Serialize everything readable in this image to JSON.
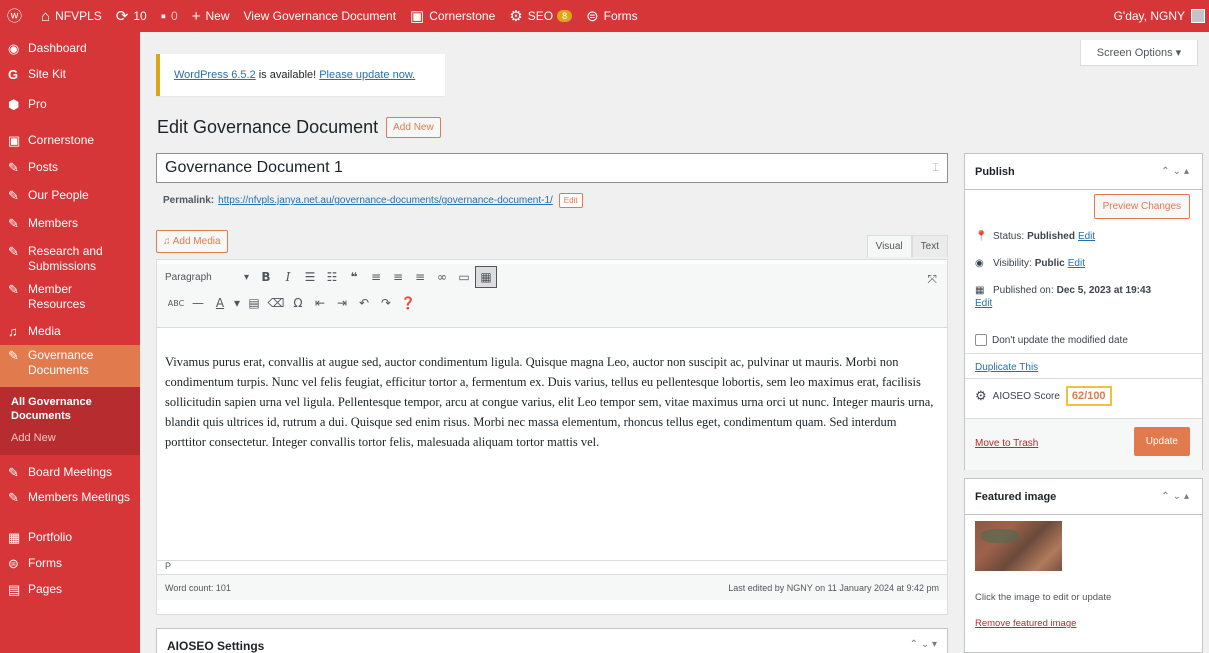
{
  "adminbar": {
    "wp_logo": "wordpress-icon",
    "site_name": "NFVPLS",
    "updates_count": "10",
    "comments_count": "0",
    "new_label": "New",
    "view_label": "View Governance Document",
    "cornerstone_label": "Cornerstone",
    "seo_label": "SEO",
    "seo_badge": "8",
    "forms_label": "Forms",
    "greeting": "G'day, NGNY"
  },
  "sidebar": {
    "items": [
      {
        "label": "Dashboard",
        "icon": "dashboard-icon"
      },
      {
        "label": "Site Kit",
        "icon": "google-icon"
      },
      {
        "label": "Pro",
        "icon": "pro-icon"
      },
      {
        "label": "Cornerstone",
        "icon": "cornerstone-icon"
      },
      {
        "label": "Posts",
        "icon": "pin-icon"
      },
      {
        "label": "Our People",
        "icon": "pin-icon"
      },
      {
        "label": "Members",
        "icon": "pin-icon"
      },
      {
        "label": "Research and Submissions",
        "icon": "pin-icon"
      },
      {
        "label": "Member Resources",
        "icon": "pin-icon"
      },
      {
        "label": "Media",
        "icon": "media-icon"
      },
      {
        "label": "Governance Documents",
        "icon": "pin-icon"
      },
      {
        "label": "Board Meetings",
        "icon": "pin-icon"
      },
      {
        "label": "Members Meetings",
        "icon": "pin-icon"
      },
      {
        "label": "Portfolio",
        "icon": "portfolio-icon"
      },
      {
        "label": "Forms",
        "icon": "forms-icon"
      },
      {
        "label": "Pages",
        "icon": "pages-icon"
      }
    ],
    "submenu": [
      "All Governance Documents",
      "Add New"
    ]
  },
  "screen_options": "Screen Options ▾",
  "notice": {
    "link1": "WordPress 6.5.2",
    "middle": "is available!",
    "link2": "Please update now."
  },
  "page": {
    "title": "Edit Governance Document",
    "add_new": "Add New",
    "post_title": "Governance Document 1",
    "permalink_label": "Permalink:",
    "permalink_url": "https://nfvpls.janya.net.au/governance-documents/governance-document-1/",
    "permalink_edit": "Edit"
  },
  "editor": {
    "add_media": "Add Media",
    "tab_visual": "Visual",
    "tab_text": "Text",
    "format_select": "Paragraph",
    "content": "Vivamus purus erat, convallis at augue sed, auctor condimentum ligula. Quisque magna Leo, auctor non suscipit ac, pulvinar ut mauris. Morbi non condimentum turpis. Nunc vel felis feugiat, efficitur tortor a, fermentum ex. Duis varius, tellus eu pellentesque lobortis, sem leo maximus erat, facilisis sollicitudin sapien urna vel ligula. Pellentesque tempor, arcu at congue varius, elit Leo tempor sem, vitae maximus urna orci ut nunc. Integer mauris urna, blandit quis ultrices id, rutrum a dui. Quisque sed enim risus. Morbi nec massa elementum, rhoncus tellus eget, condimentum quam. Sed interdum porttitor consectetur. Integer convallis tortor felis, malesuada aliquam tortor mattis vel.",
    "path": "P",
    "word_count": "Word count: 101",
    "last_edited": "Last edited by NGNY on 11 January 2024 at 9:42 pm"
  },
  "aioseo_box": {
    "title": "AIOSEO Settings"
  },
  "publish": {
    "title": "Publish",
    "preview": "Preview Changes",
    "status_label": "Status:",
    "status_value": "Published",
    "visibility_label": "Visibility:",
    "visibility_value": "Public",
    "published_label": "Published on:",
    "published_value": "Dec 5, 2023 at 19:43",
    "edit": "Edit",
    "dont_update": "Don't update the modified date",
    "duplicate": "Duplicate This",
    "aioseo_label": "AIOSEO Score",
    "aioseo_score": "62/100",
    "trash": "Move to Trash",
    "update": "Update"
  },
  "featured": {
    "title": "Featured image",
    "help": "Click the image to edit or update",
    "remove": "Remove featured image"
  },
  "colors": {
    "adminbar": "#d63638",
    "sidebar": "#d63638",
    "accent": "#e17a4d",
    "link": "#2271b1"
  }
}
